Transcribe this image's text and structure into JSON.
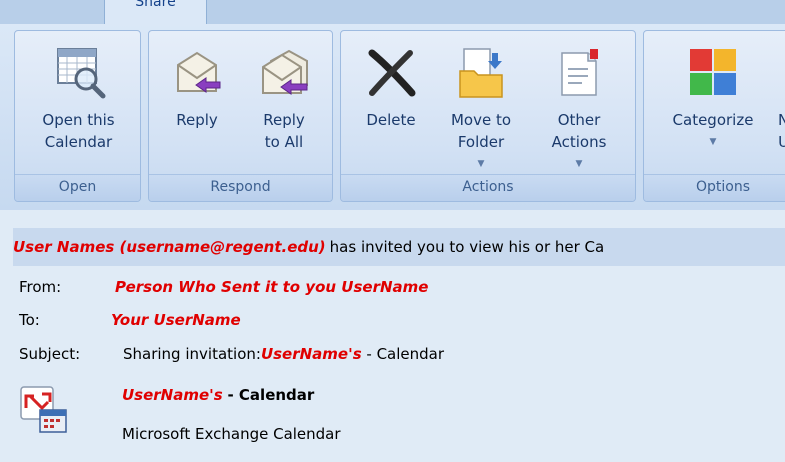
{
  "tabs": {
    "active": "Share"
  },
  "ribbon": {
    "groups": [
      {
        "label": "Open",
        "buttons": [
          {
            "line1": "Open this",
            "line2": "Calendar"
          }
        ]
      },
      {
        "label": "Respond",
        "buttons": [
          {
            "line1": "Reply",
            "line2": ""
          },
          {
            "line1": "Reply",
            "line2": "to All"
          }
        ]
      },
      {
        "label": "Actions",
        "buttons": [
          {
            "line1": "Delete",
            "line2": ""
          },
          {
            "line1": "Move to",
            "line2": "Folder"
          },
          {
            "line1": "Other",
            "line2": "Actions"
          }
        ]
      },
      {
        "label": "Options",
        "buttons": [
          {
            "line1": "Categorize",
            "line2": ""
          }
        ]
      }
    ]
  },
  "message": {
    "infobar": {
      "sender": "User Names (username@regent.edu)",
      "text": "has invited you to view his or her Ca"
    },
    "from_label": "From:",
    "from_value": "Person Who Sent it to you UserName",
    "to_label": "To:",
    "to_value": "Your UserName",
    "subject_label": "Subject:",
    "subject_prefix": "Sharing invitation:",
    "subject_name": "UserName's",
    "subject_suffix": "- Calendar",
    "attachment": {
      "name": "UserName's",
      "name_suffix": "- Calendar",
      "type": "Microsoft Exchange Calendar"
    }
  },
  "colors": {
    "highlight_red": "#e00000",
    "ribbon_text": "#1b3a6b",
    "infobar_bg": "#c8d9ee"
  }
}
